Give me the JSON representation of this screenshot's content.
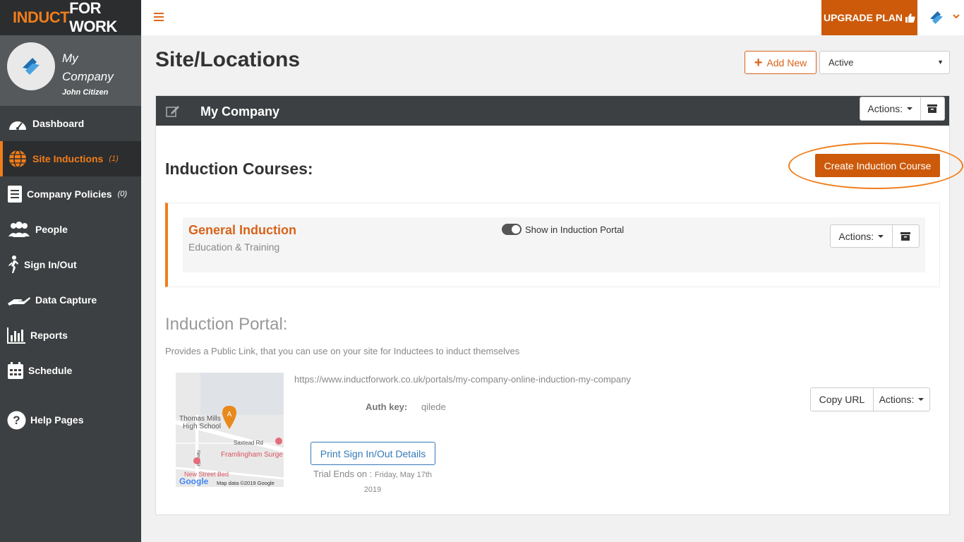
{
  "brand": {
    "part1": "INDUCT",
    "part2": "FOR WORK",
    "accent": "#f07d1a"
  },
  "profile": {
    "company": "My Company",
    "user": "John Citizen"
  },
  "sidebar": {
    "items": [
      {
        "label": "Dashboard",
        "icon": "speedometer-icon",
        "count": ""
      },
      {
        "label": "Site Inductions",
        "icon": "globe-icon",
        "count": "(1)"
      },
      {
        "label": "Company Policies",
        "icon": "document-icon",
        "count": "(0)"
      },
      {
        "label": "People",
        "icon": "people-icon",
        "count": ""
      },
      {
        "label": "Sign In/Out",
        "icon": "walking-person-icon",
        "count": ""
      },
      {
        "label": "Data Capture",
        "icon": "hand-icon",
        "count": ""
      },
      {
        "label": "Reports",
        "icon": "bar-chart-icon",
        "count": ""
      },
      {
        "label": "Schedule",
        "icon": "calendar-icon",
        "count": ""
      },
      {
        "label": "Help Pages",
        "icon": "question-icon",
        "count": ""
      }
    ]
  },
  "topbar": {
    "upgrade_label": "UPGRADE PLAN"
  },
  "page": {
    "title": "Site/Locations",
    "add_new_label": "Add New",
    "status_filter": "Active"
  },
  "site": {
    "name": "My Company",
    "actions_label": "Actions:",
    "courses_heading": "Induction Courses:",
    "create_course_label": "Create Induction Course",
    "course": {
      "name": "General Induction",
      "category": "Education & Training",
      "portal_toggle_label": "Show in Induction Portal",
      "portal_toggle_on": true,
      "actions_label": "Actions:"
    },
    "portal": {
      "heading": "Induction Portal:",
      "description": "Provides a Public Link, that you can use on your site for Inductees to induct themselves",
      "url": "https://www.inductforwork.co.uk/portals/my-company-online-induction-my-company",
      "auth_key_label": "Auth key:",
      "auth_key": "qilede",
      "copy_url_label": "Copy URL",
      "actions_label": "Actions:",
      "print_label": "Print Sign In/Out Details",
      "trial_label": "Trial Ends on :",
      "trial_date": "Friday, May 17th 2019",
      "map": {
        "place1": "Thomas Mills",
        "place1b": "High School",
        "street1": "Saxtead Rd",
        "street2": "New St",
        "place2": "Framlingham Surge",
        "place3": "New Street Bed",
        "google": "Google",
        "credit": "Map data ©2019 Google",
        "pin_letter": "A"
      }
    }
  }
}
